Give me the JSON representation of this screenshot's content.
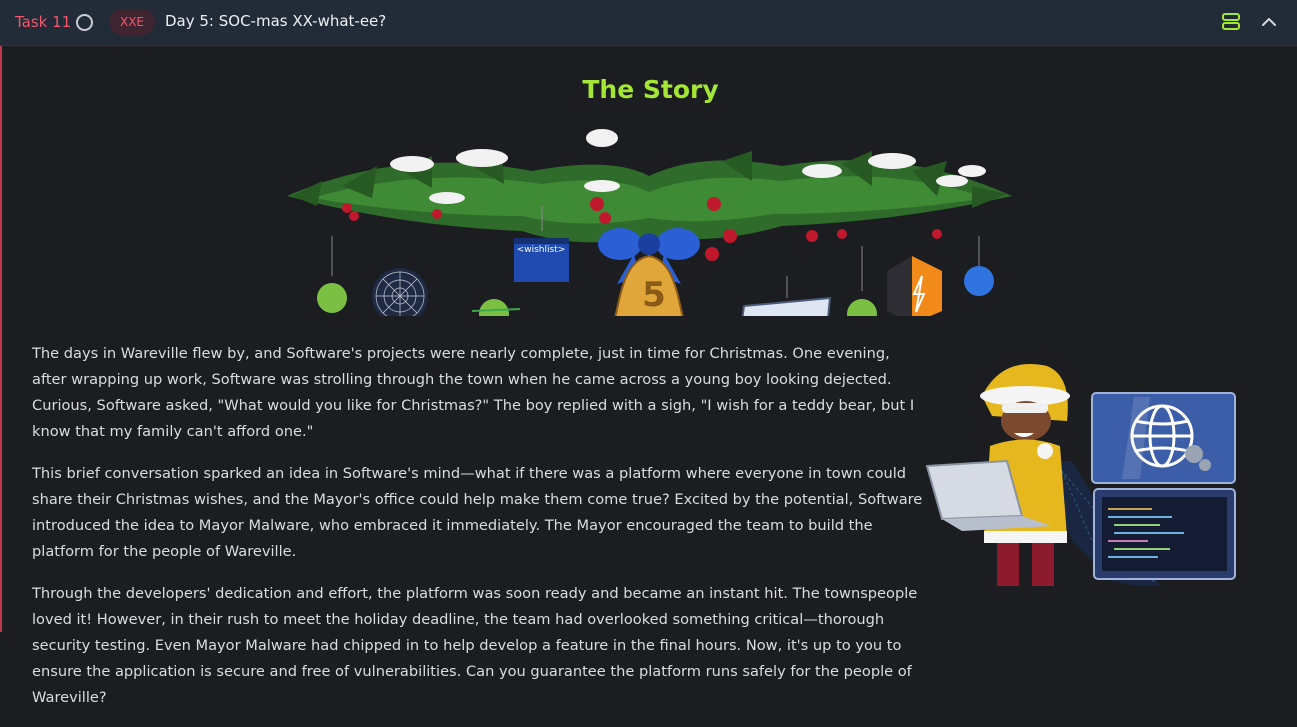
{
  "task": {
    "number": "Task 11",
    "tag": "XXE",
    "title": "Day 5: SOC-mas XX-what-ee?"
  },
  "story": {
    "heading": "The Story",
    "banner": {
      "wishlist_label": "<wishlist>",
      "bell_number": "5"
    },
    "paragraphs": [
      "The days in Wareville flew by, and Software's projects were nearly complete, just in time for Christmas. One evening, after wrapping up work, Software was strolling through the town when he came across a young boy looking dejected. Curious, Software asked, \"What would you like for Christmas?\" The boy replied with a sigh, \"I wish for a teddy bear, but I know that my family can't afford one.\"",
      "This brief conversation sparked an idea in Software's mind—what if there was a platform where everyone in town could share their Christmas wishes, and the Mayor's office could help make them come true? Excited by the potential, Software introduced the idea to Mayor Malware, who embraced it immediately. The Mayor encouraged the team to build the platform for the people of Wareville.",
      "Through the developers' dedication and effort, the platform was soon ready and became an instant hit. The townspeople loved it! However, in their rush to meet the holiday deadline, the team had overlooked something critical—thorough security testing. Even Mayor Malware had chipped in to help develop a feature in the final hours. Now, it's up to you to ensure the application is secure and free of vulnerabilities. Can you guarantee the platform runs safely for the people of Wareville?"
    ]
  },
  "icons": {
    "task_status": "circle-outline-icon",
    "layout_toggle": "stacked-rows-icon",
    "collapse": "chevron-up-icon"
  },
  "colors": {
    "accent_red": "#f2566a",
    "heading_green": "#a3e635",
    "header_bg": "#222b38",
    "page_bg": "#1c1d20"
  }
}
